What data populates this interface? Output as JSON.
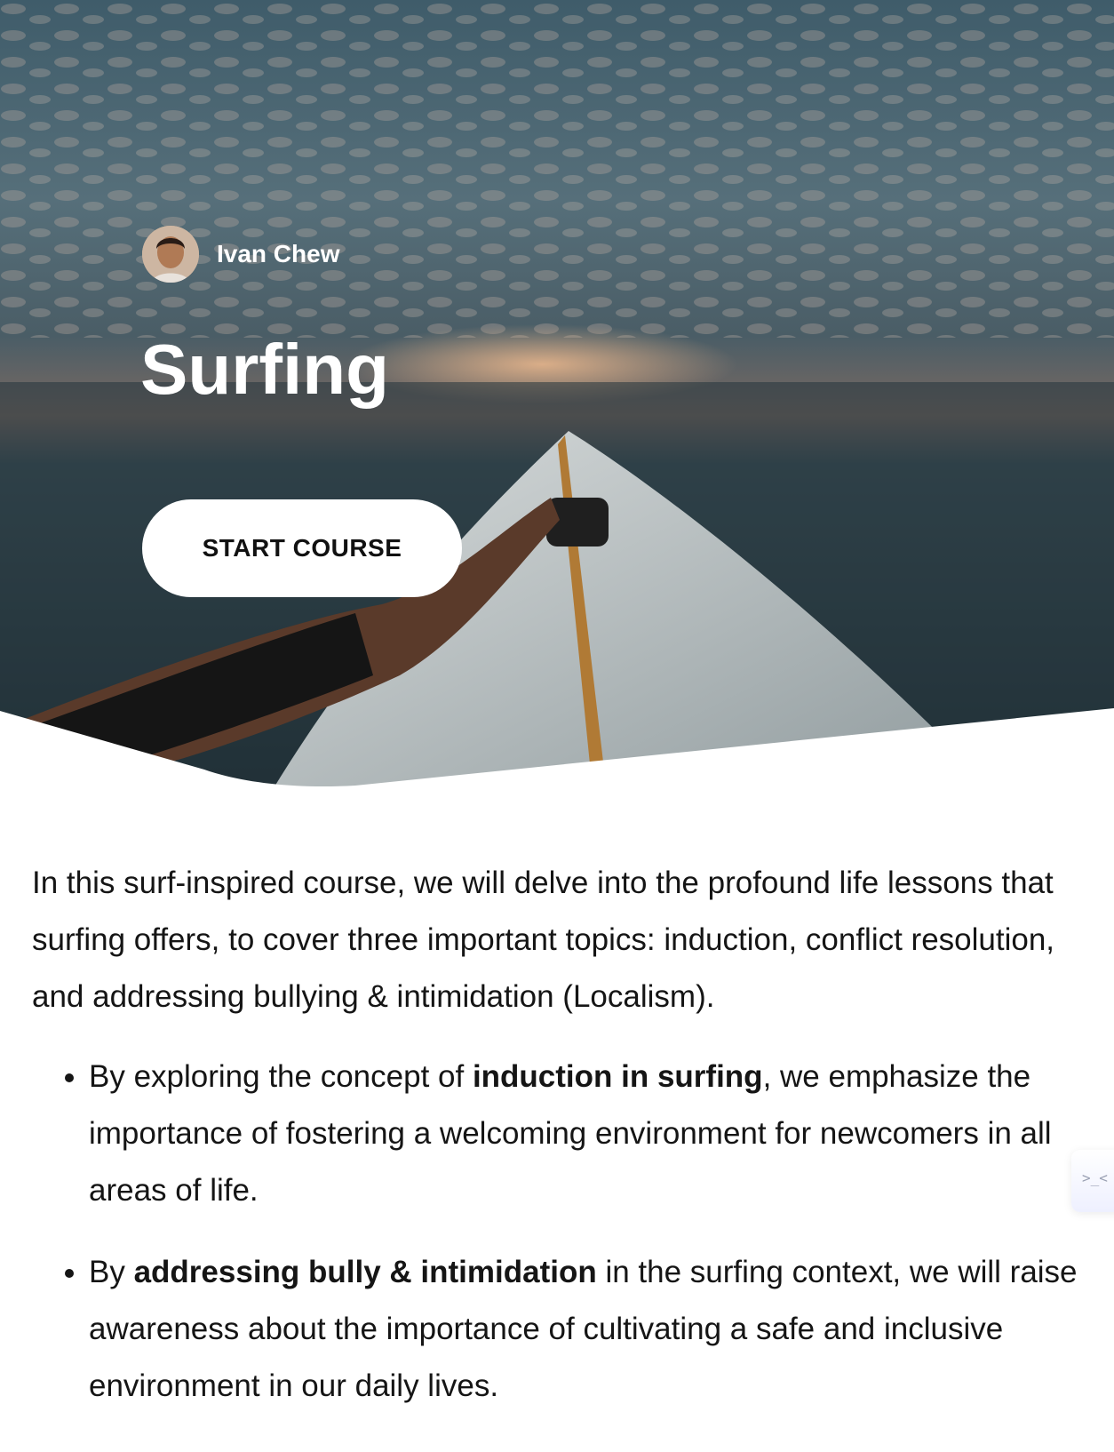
{
  "hero": {
    "author_name": "Ivan Chew",
    "title": "Surfing",
    "start_button_label": "START COURSE"
  },
  "content": {
    "intro": "In this surf-inspired course, we will delve into the profound life lessons that surfing offers, to cover three important topics: induction, conflict resolution, and addressing bullying & intimidation (Localism).",
    "bullets": [
      {
        "before": "By exploring the concept of ",
        "bold": "induction in surfing",
        "after": ", we emphasize the importance of fostering a welcoming environment for newcomers in all areas of life."
      },
      {
        "before": "By ",
        "bold": "addressing bully & intimidation",
        "after": " in the surfing context, we will raise awareness about the importance of cultivating a safe and inclusive environment in our daily lives."
      }
    ]
  },
  "widget": {
    "glyph": ">_<"
  },
  "icons": {
    "avatar": "avatar-photo-icon"
  },
  "colors": {
    "button_bg": "#ffffff",
    "hero_text": "#ffffff",
    "body_text": "#151515"
  }
}
